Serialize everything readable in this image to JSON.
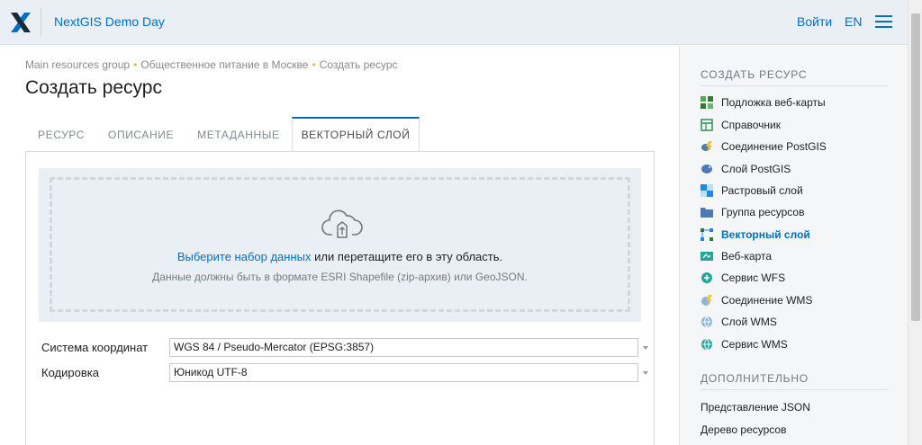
{
  "header": {
    "app_title": "NextGIS Demo Day",
    "login_label": "Войти",
    "lang_label": "EN",
    "brand_color": "#0070c5"
  },
  "breadcrumb": {
    "items": [
      "Main resources group",
      "Общественное питание в Москве",
      "Создать ресурс"
    ],
    "separator": "•"
  },
  "page_title": "Создать ресурс",
  "tabs": [
    {
      "label": "РЕСУРС",
      "active": false
    },
    {
      "label": "ОПИСАНИЕ",
      "active": false
    },
    {
      "label": "МЕТАДАННЫЕ",
      "active": false
    },
    {
      "label": "ВЕКТОРНЫЙ СЛОЙ",
      "active": true
    }
  ],
  "dropzone": {
    "link_text": "Выберите набор данных",
    "main_text": " или перетащите его в эту область.",
    "hint": "Данные должны быть в формате ESRI Shapefile (zip-архив) или GeoJSON.",
    "icon": "cloud-upload-icon"
  },
  "form": {
    "srs_label": "Система координат",
    "srs_value": "WGS 84 / Pseudo-Mercator (EPSG:3857)",
    "encoding_label": "Кодировка",
    "encoding_value": "Юникод UTF-8"
  },
  "sidebar": {
    "create_heading": "СОЗДАТЬ РЕСУРС",
    "items": [
      {
        "label": "Подложка веб-карты",
        "icon": "basemap-icon"
      },
      {
        "label": "Справочник",
        "icon": "lookup-table-icon"
      },
      {
        "label": "Соединение PostGIS",
        "icon": "postgis-connection-icon"
      },
      {
        "label": "Слой PostGIS",
        "icon": "postgis-layer-icon"
      },
      {
        "label": "Растровый слой",
        "icon": "raster-layer-icon"
      },
      {
        "label": "Группа ресурсов",
        "icon": "folder-icon"
      },
      {
        "label": "Векторный слой",
        "icon": "vector-layer-icon",
        "active": true
      },
      {
        "label": "Веб-карта",
        "icon": "webmap-icon"
      },
      {
        "label": "Сервис WFS",
        "icon": "wfs-service-icon"
      },
      {
        "label": "Соединение WMS",
        "icon": "wms-connection-icon"
      },
      {
        "label": "Слой WMS",
        "icon": "wms-layer-icon"
      },
      {
        "label": "Сервис WMS",
        "icon": "wms-service-icon"
      }
    ],
    "extra_heading": "ДОПОЛНИТЕЛЬНО",
    "extra_items": [
      "Представление JSON",
      "Дерево ресурсов"
    ]
  }
}
